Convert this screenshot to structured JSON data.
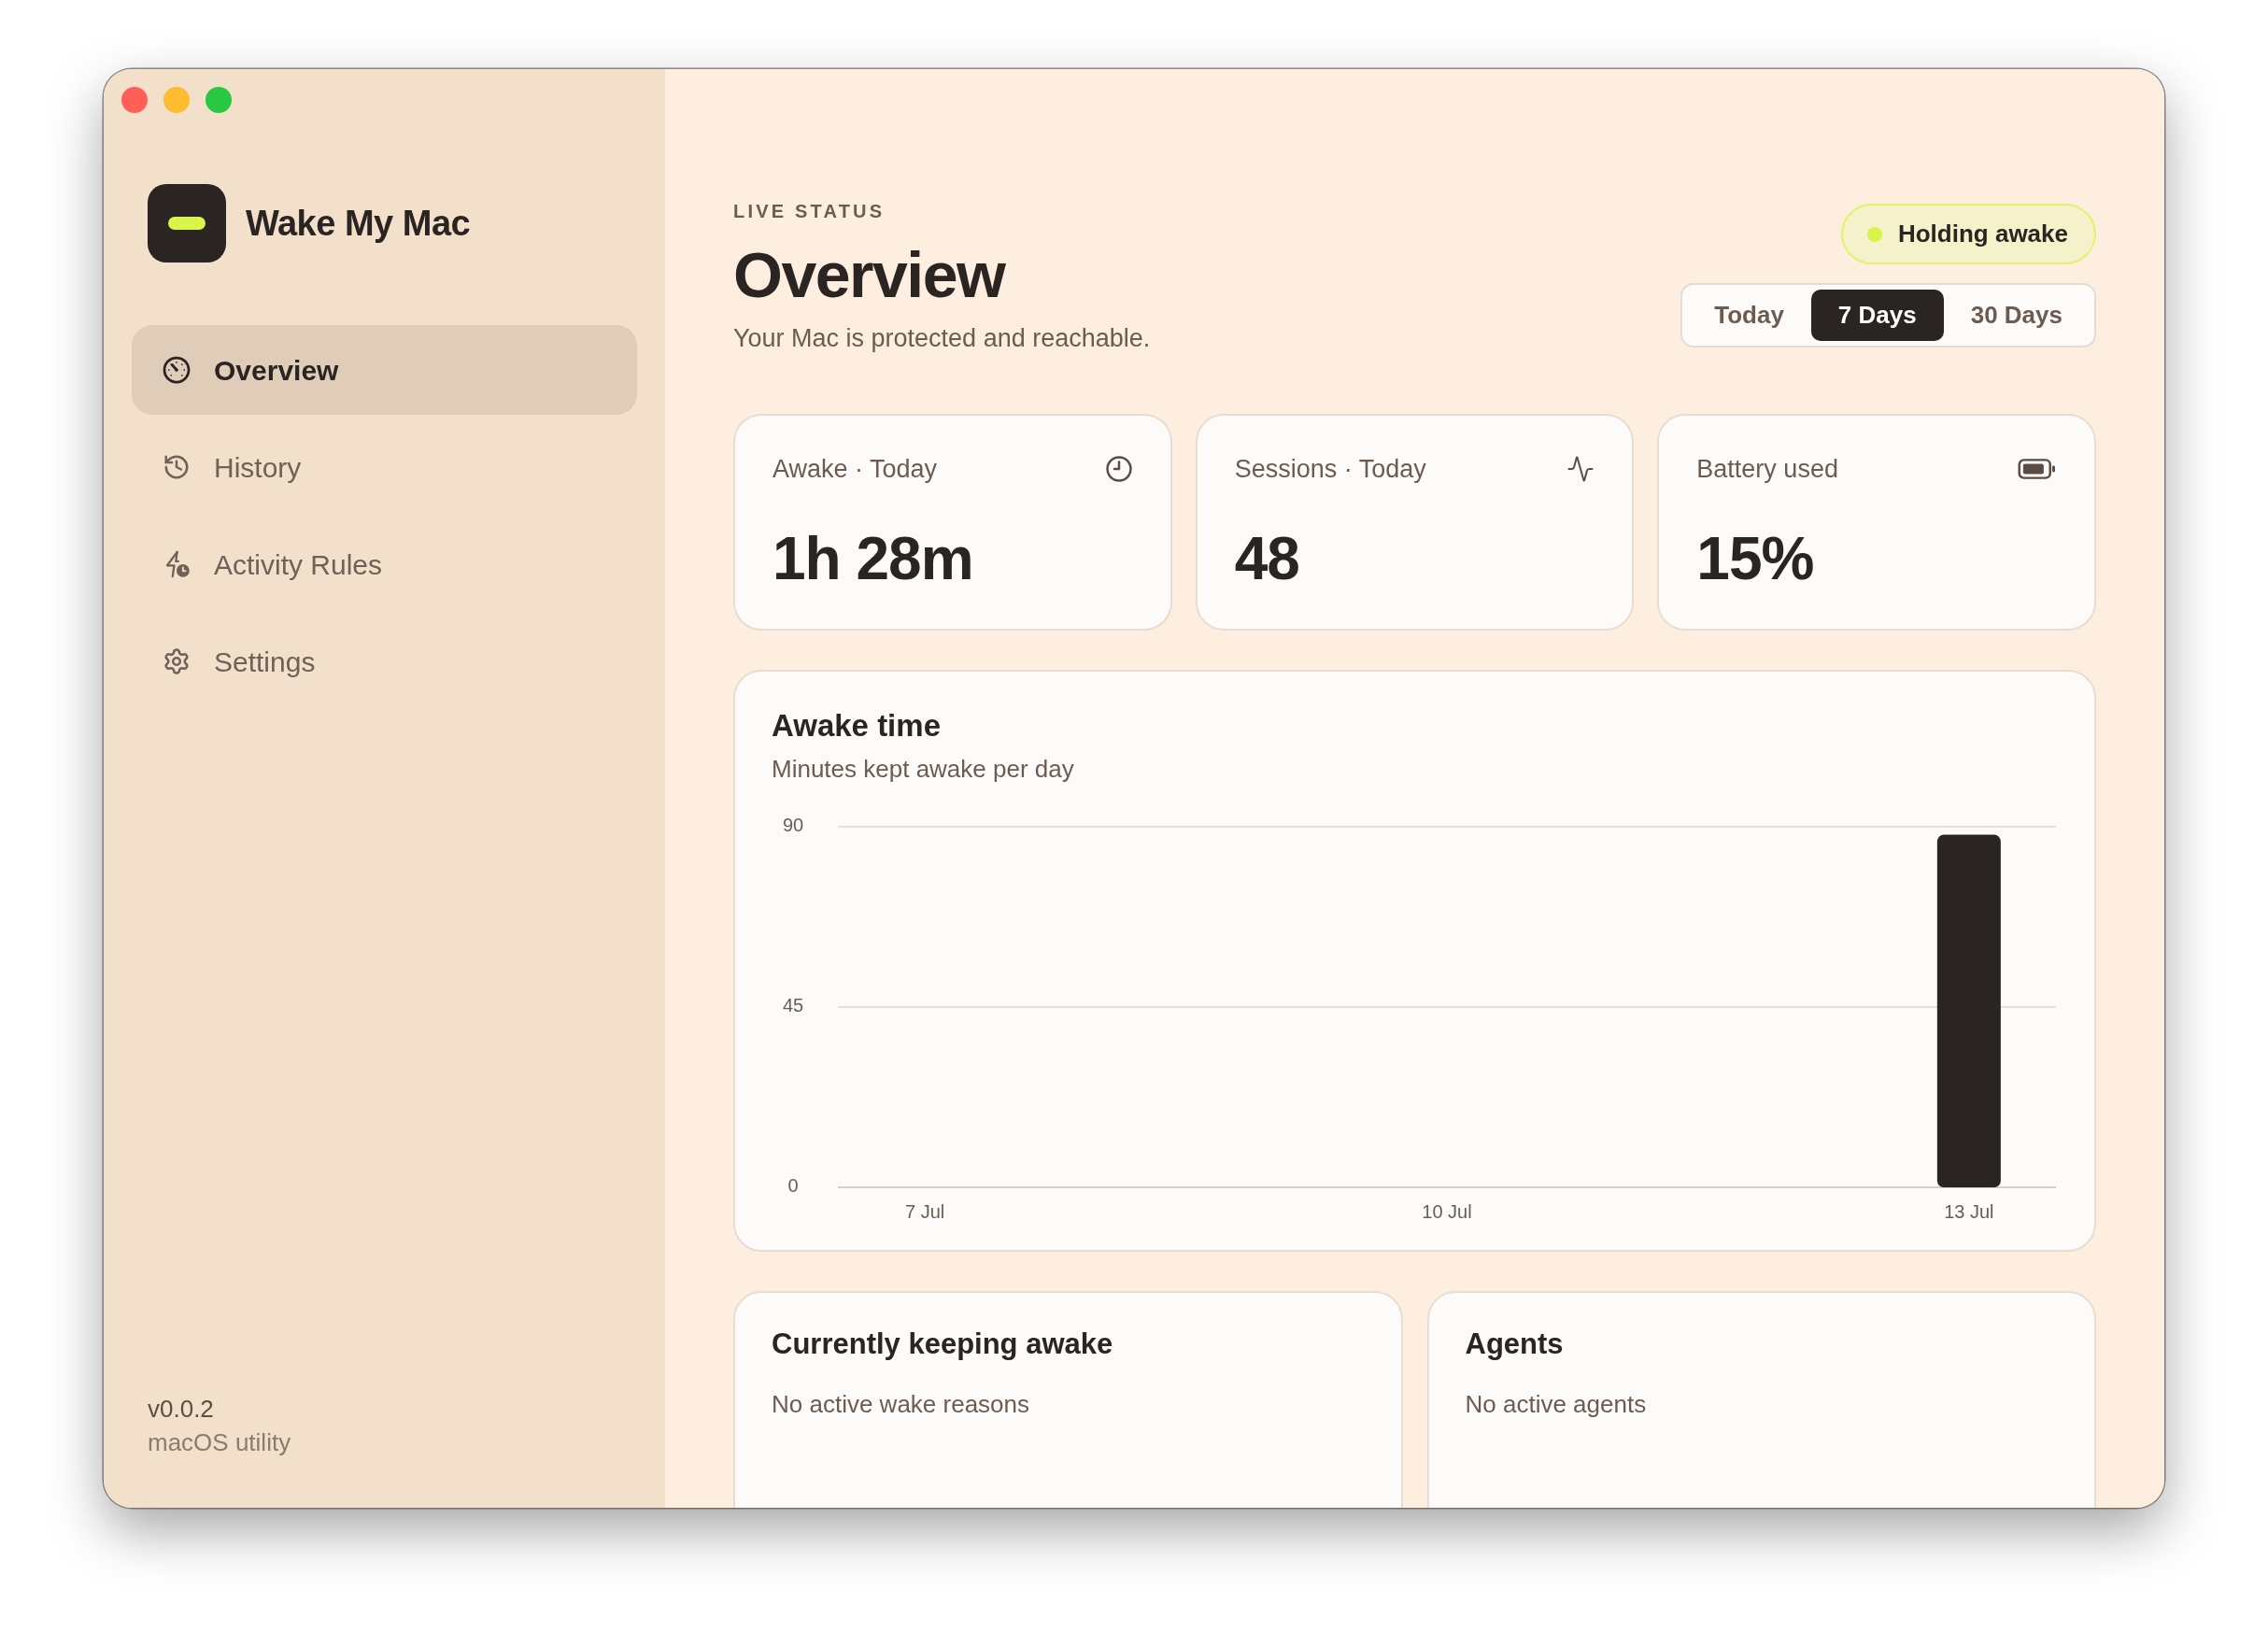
{
  "sidebar": {
    "app_name": "Wake My Mac",
    "nav_items": [
      {
        "label": "Overview",
        "selected": true
      },
      {
        "label": "History",
        "selected": false
      },
      {
        "label": "Activity Rules",
        "selected": false
      },
      {
        "label": "Settings",
        "selected": false
      }
    ],
    "footer": {
      "version": "v0.0.2",
      "subtitle": "macOS utility"
    }
  },
  "header": {
    "eyebrow": "LIVE STATUS",
    "title": "Overview",
    "subtitle": "Your Mac is protected and reachable.",
    "status_badge": "Holding awake",
    "range_tabs": [
      {
        "label": "Today",
        "selected": false
      },
      {
        "label": "7 Days",
        "selected": true
      },
      {
        "label": "30 Days",
        "selected": false
      }
    ]
  },
  "stats": [
    {
      "label": "Awake · Today",
      "value": "1h 28m"
    },
    {
      "label": "Sessions · Today",
      "value": "48"
    },
    {
      "label": "Battery used",
      "value": "15%"
    }
  ],
  "awake_chart": {
    "title": "Awake time",
    "subtitle": "Minutes kept awake per day",
    "chart_data": {
      "type": "bar",
      "categories": [
        "7 Jul",
        null,
        null,
        "10 Jul",
        null,
        null,
        "13 Jul"
      ],
      "values": [
        0,
        0,
        0,
        0,
        0,
        0,
        88
      ],
      "ylim": [
        0,
        90
      ],
      "yticks": [
        0,
        45,
        90
      ]
    }
  },
  "panels": [
    {
      "title": "Currently keeping awake",
      "empty_text": "No active wake reasons"
    },
    {
      "title": "Agents",
      "empty_text": "No active agents"
    }
  ]
}
